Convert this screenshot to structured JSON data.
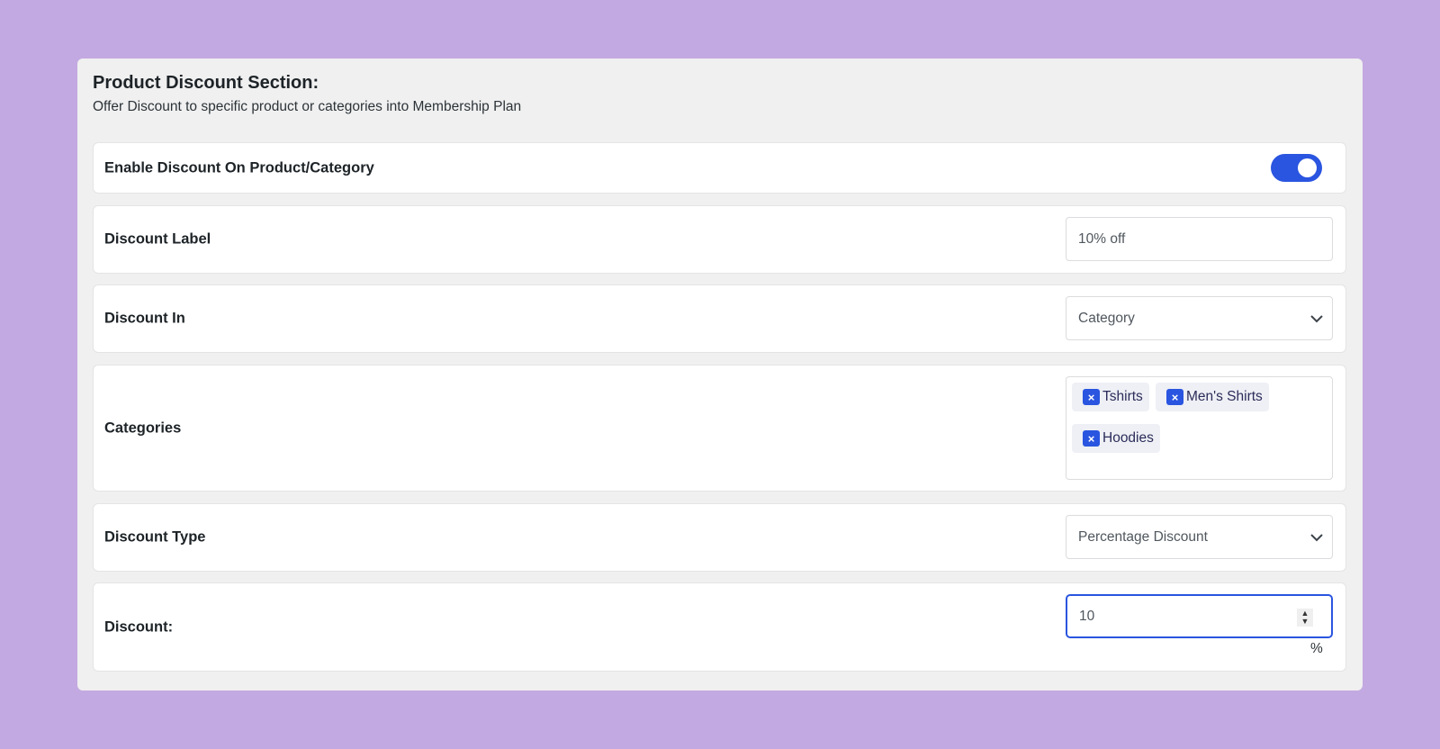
{
  "section": {
    "title": "Product Discount Section:",
    "subtitle": "Offer Discount to specific product or categories into Membership Plan"
  },
  "enable": {
    "label": "Enable Discount On Product/Category",
    "on": true
  },
  "discount_label": {
    "label": "Discount Label",
    "value": "10% off"
  },
  "discount_in": {
    "label": "Discount In",
    "value": "Category"
  },
  "categories": {
    "label": "Categories",
    "tags": [
      "Tshirts",
      "Men's Shirts",
      "Hoodies"
    ],
    "remove_glyph": "×"
  },
  "discount_type": {
    "label": "Discount Type",
    "value": "Percentage Discount"
  },
  "discount": {
    "label": "Discount:",
    "value": "10",
    "unit": "%",
    "spin_up": "▲",
    "spin_down": "▼"
  },
  "colors": {
    "accent": "#2a55e0",
    "background": "#c3a9e1"
  }
}
